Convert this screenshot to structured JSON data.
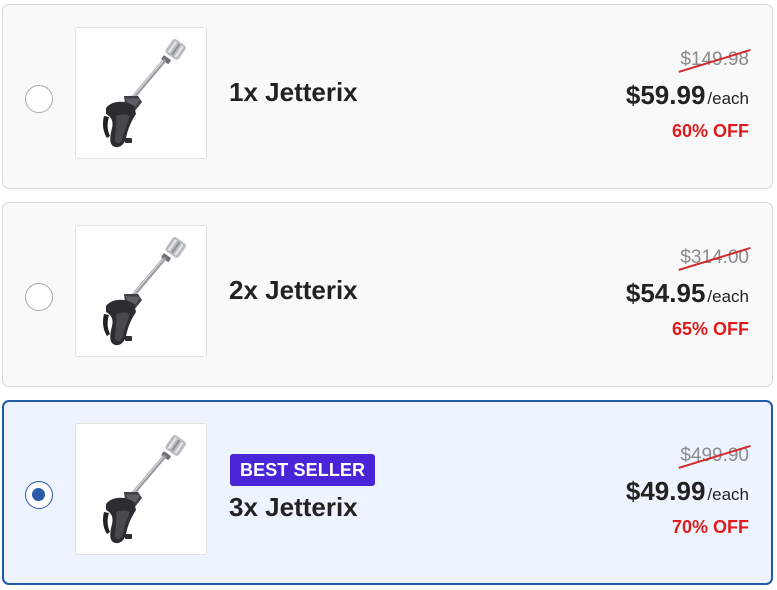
{
  "offers": [
    {
      "title": "1x Jetterix",
      "old_price": "$149.98",
      "price": "$59.99",
      "per_unit": "/each",
      "discount": "60% OFF",
      "selected": false,
      "product_image": "spray-nozzle-wand"
    },
    {
      "title": "2x Jetterix",
      "old_price": "$314.00",
      "price": "$54.95",
      "per_unit": "/each",
      "discount": "65% OFF",
      "selected": false,
      "product_image": "spray-nozzle-wand"
    },
    {
      "title": "3x Jetterix",
      "badge": "BEST SELLER",
      "old_price": "$499.90",
      "price": "$49.99",
      "per_unit": "/each",
      "discount": "70% OFF",
      "selected": true,
      "product_image": "spray-nozzle-wand"
    }
  ],
  "colors": {
    "selected_border": "#1f5cab",
    "selected_bg": "#eef4ff",
    "badge_bg": "#4a25d8",
    "discount_text": "#e01b1b",
    "strike_line": "#d22a2a"
  }
}
